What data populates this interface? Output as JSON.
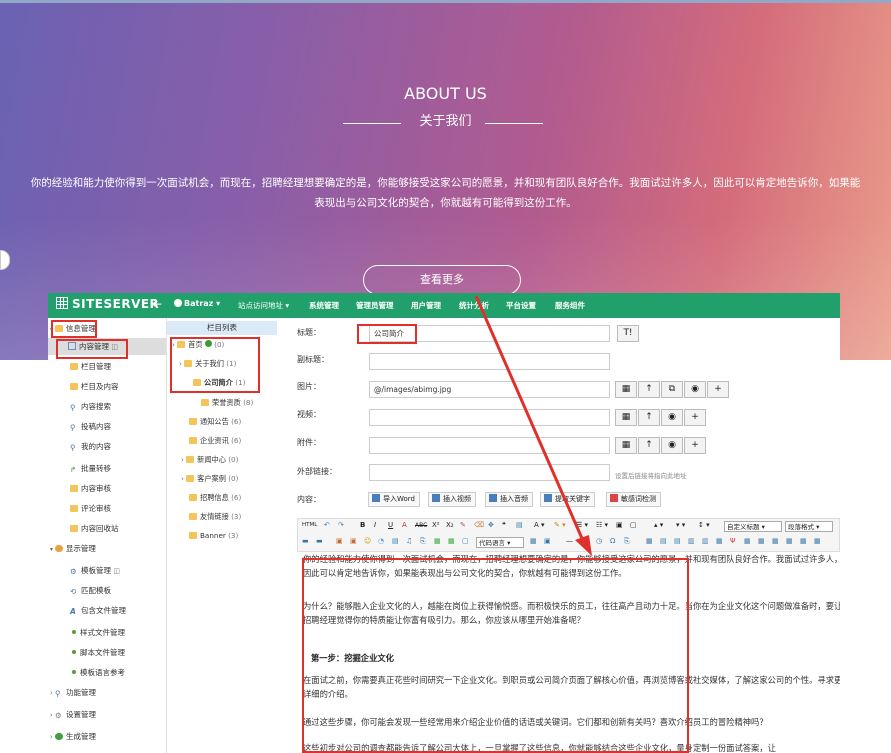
{
  "hero": {
    "title": "ABOUT US",
    "subtitle": "关于我们",
    "text": "你的经验和能力使你得到一次面试机会，而现在，招聘经理想要确定的是，你能够接受这家公司的愿景，并和现有团队良好合作。我面试过许多人，因此可以肯定地告诉你，如果能表现出与公司文化的契合，你就越有可能得到这份工作。",
    "button": "查看更多"
  },
  "topbar": {
    "logo": "SITESERVER",
    "back": "←",
    "user": "Batraz ▾",
    "nav": [
      "站点访问地址 ▾",
      "系统管理",
      "管理员管理",
      "用户管理",
      "统计分析",
      "平台设置",
      "服务组件"
    ]
  },
  "sidebar": {
    "items": [
      {
        "label": "信息管理",
        "type": "group"
      },
      {
        "label": "内容管理",
        "type": "child"
      },
      {
        "label": "栏目管理",
        "type": "child"
      },
      {
        "label": "栏目及内容",
        "type": "child"
      },
      {
        "label": "内容搜索",
        "type": "child"
      },
      {
        "label": "投稿内容",
        "type": "child"
      },
      {
        "label": "我的内容",
        "type": "child"
      },
      {
        "label": "批量转移",
        "type": "child"
      },
      {
        "label": "内容审核",
        "type": "child"
      },
      {
        "label": "评论审核",
        "type": "child"
      },
      {
        "label": "内容回收站",
        "type": "child"
      },
      {
        "label": "显示管理",
        "type": "group"
      },
      {
        "label": "模板管理",
        "type": "child"
      },
      {
        "label": "匹配模板",
        "type": "child"
      },
      {
        "label": "包含文件管理",
        "type": "child"
      },
      {
        "label": "样式文件管理",
        "type": "child"
      },
      {
        "label": "脚本文件管理",
        "type": "child"
      },
      {
        "label": "模板语言参考",
        "type": "child"
      },
      {
        "label": "功能管理",
        "type": "group"
      },
      {
        "label": "设置管理",
        "type": "group"
      },
      {
        "label": "生成管理",
        "type": "group"
      }
    ]
  },
  "tree": {
    "header": "栏目列表",
    "items": [
      {
        "label": "首页",
        "count": "(0)"
      },
      {
        "label": "关于我们",
        "count": "(1)"
      },
      {
        "label": "公司简介",
        "count": "(1)"
      },
      {
        "label": "荣誉资质",
        "count": "(8)"
      },
      {
        "label": "通知公告",
        "count": "(6)"
      },
      {
        "label": "企业资讯",
        "count": "(6)"
      },
      {
        "label": "新闻中心",
        "count": "(0)"
      },
      {
        "label": "客户案例",
        "count": "(0)"
      },
      {
        "label": "招聘信息",
        "count": "(6)"
      },
      {
        "label": "友情链接",
        "count": "(3)"
      },
      {
        "label": "Banner",
        "count": "(3)"
      }
    ]
  },
  "form": {
    "title_label": "标题：",
    "title_value": "公司简介",
    "title_btn": "T!",
    "subtitle_label": "副标题：",
    "image_label": "图片：",
    "image_value": "@/images/abimg.jpg",
    "video_label": "视频：",
    "attach_label": "附件：",
    "link_label": "外部链接：",
    "link_hint": "设置后链接将指向此地址",
    "content_label": "内容：",
    "content_buttons": [
      "导入Word",
      "插入视频",
      "插入音频",
      "提取关键字",
      "敏感词检测"
    ]
  },
  "toolbar": {
    "custom_title": "自定义标题",
    "paragraph": "段落格式",
    "code_lang": "代码语言"
  },
  "editor": {
    "p1": "你的经验和能力使你得到一次面试机会，而现在，招聘经理想要确定的是，你能够接受这家公司的愿景，并和现有团队良好合作。我面试过许多人，因此可以肯定地告诉你，如果能表现出与公司文化的契合，你就越有可能得到这份工作。",
    "p2": "为什么？能够融入企业文化的人，越能在岗位上获得愉悦感。而积极快乐的员工，往往高产且动力十足。当你在为企业文化这个问题做准备时，要让招聘经理觉得你的特质能让你富有吸引力。那么，你应该从哪里开始准备呢？",
    "step1": "第一步：挖掘企业文化",
    "p3": "在面试之前，你需要真正花些时间研究一下企业文化。到职员或公司简介页面了解核心价值，再浏览博客或社交媒体，了解这家公司的个性。寻求更详细的介绍。",
    "p4": "通过这些步骤，你可能会发现一些经常用来介绍企业价值的话语或关键词。它们都和创新有关吗？喜欢介绍员工的冒险精神吗？",
    "p5": "这些初步对公司的调查都能告诉了解公司大体上，一旦掌握了这些信息，你就能够结合这些企业文化，量身定制一份面试答案，让"
  },
  "colors": {
    "topbar": "#22a06b",
    "highlight": "#e0302c"
  }
}
